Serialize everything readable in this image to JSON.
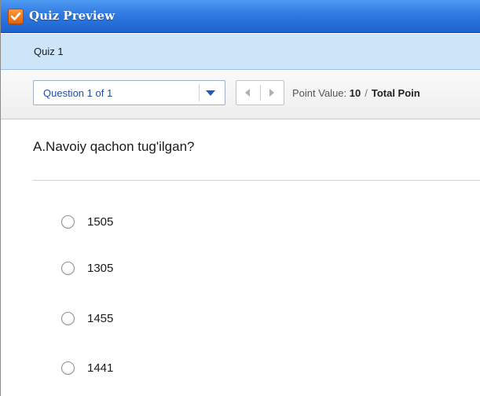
{
  "window": {
    "title": "Quiz Preview",
    "icon": "checkmark-icon"
  },
  "quiz": {
    "name": "Quiz 1"
  },
  "toolbar": {
    "question_select_value": "Question 1 of 1",
    "prev_icon": "left-triangle-icon",
    "next_icon": "right-triangle-icon",
    "point_value_label": "Point Value:",
    "point_value": "10",
    "separator": "/",
    "total_points_label": "Total Poin"
  },
  "question": {
    "text": "A.Navoiy qachon tug'ilgan?",
    "answers": [
      {
        "label": "1505",
        "selected": false
      },
      {
        "label": "1305",
        "selected": false
      },
      {
        "label": "1455",
        "selected": false
      },
      {
        "label": "1441",
        "selected": false
      }
    ]
  },
  "colors": {
    "titlebar": "#2f79e1",
    "quizbar": "#cde5f8",
    "link_blue": "#1d4fa3",
    "icon_orange": "#e2620a"
  }
}
